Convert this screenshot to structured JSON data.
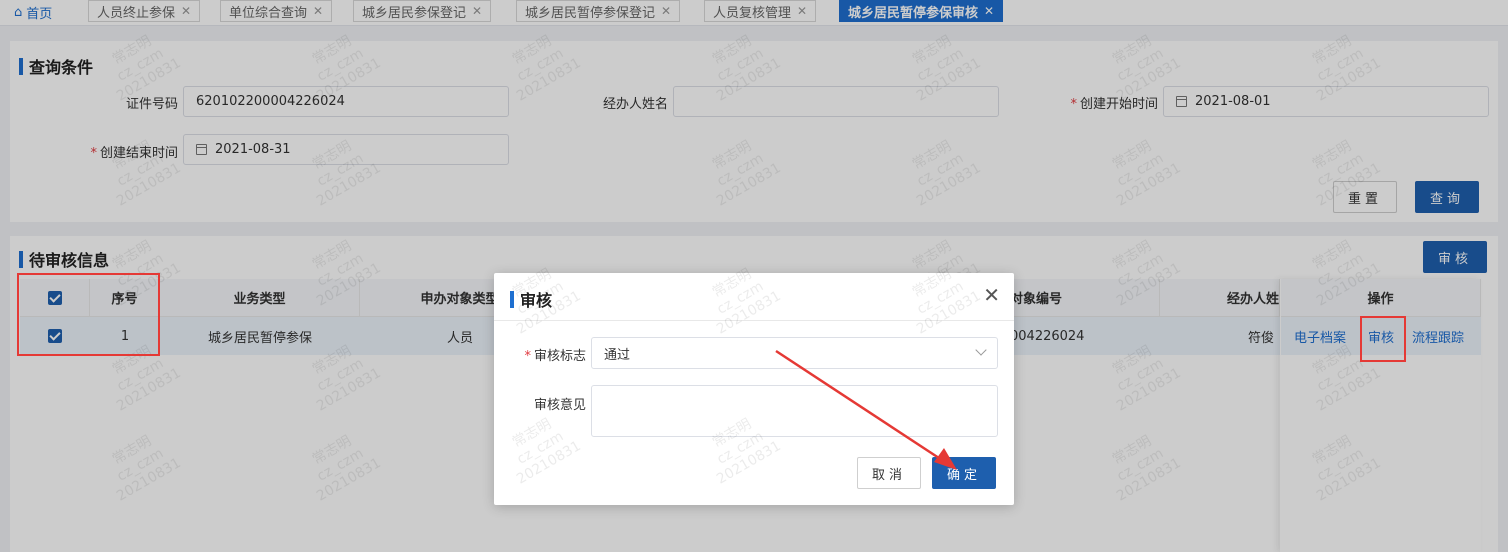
{
  "tabs": {
    "home": "首页",
    "items": [
      {
        "label": "人员终止参保"
      },
      {
        "label": "单位综合查询"
      },
      {
        "label": "城乡居民参保登记"
      },
      {
        "label": "城乡居民暂停参保登记"
      },
      {
        "label": "人员复核管理"
      },
      {
        "label": "城乡居民暂停参保审核",
        "active": true
      }
    ]
  },
  "query": {
    "title": "查询条件",
    "id_label": "证件号码",
    "id_value": "620102200004226024",
    "operator_label": "经办人姓名",
    "operator_value": "",
    "start_label": "创建开始时间",
    "start_value": "2021-08-01",
    "end_label": "创建结束时间",
    "end_value": "2021-08-31",
    "reset_label": "重置",
    "search_label": "查询"
  },
  "pending": {
    "title": "待审核信息",
    "audit_button": "审核",
    "columns": [
      "序号",
      "业务类型",
      "申办对象类型",
      "对象编号",
      "经办人姓",
      "操作"
    ],
    "row": {
      "index": "1",
      "business_type": "城乡居民暂停参保",
      "object_type": "人员",
      "object_no": "004226024",
      "operator": "符俊"
    },
    "actions": [
      "电子档案",
      "审核",
      "流程跟踪"
    ]
  },
  "modal": {
    "title": "审核",
    "flag_label": "审核标志",
    "flag_value": "通过",
    "opinion_label": "审核意见",
    "cancel_label": "取消",
    "confirm_label": "确定"
  },
  "watermark": [
    "常志明",
    "cz_czm",
    "20210831"
  ],
  "colors": {
    "primary": "#1e6fd0",
    "button": "#1e5fae",
    "required": "#e0383e",
    "highlight": "#e53935"
  }
}
